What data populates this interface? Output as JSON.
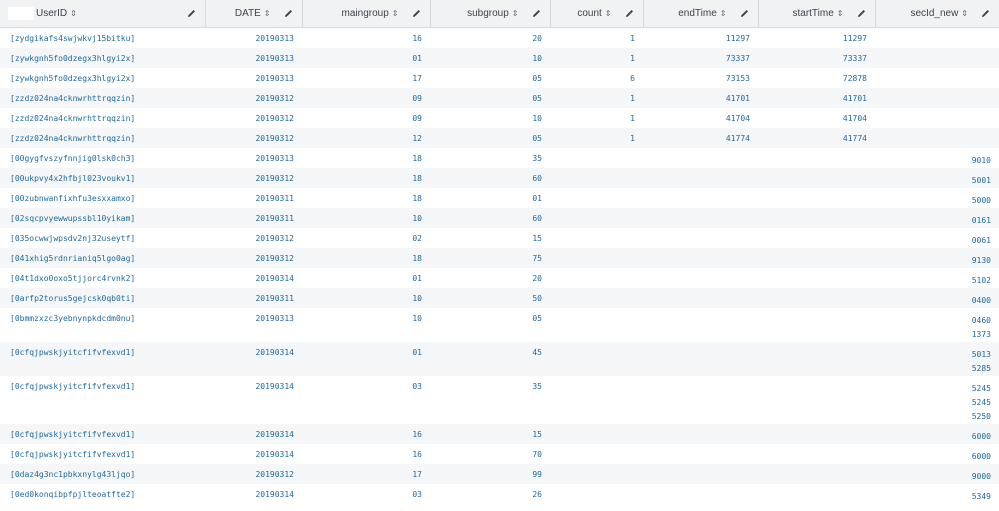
{
  "columns": [
    "UserID",
    "DATE",
    "maingroup",
    "subgroup",
    "count",
    "endTime",
    "startTime",
    "secId_new"
  ],
  "sort_icon": "⇕",
  "rows": [
    {
      "uid": "[zydgikafs4swjwkvj15bitku]",
      "date": "20190313",
      "main": "16",
      "sub": "20",
      "count": "1",
      "end": "11297",
      "start": "11297",
      "sec": []
    },
    {
      "uid": "[zywkgnh5fo0dzegx3hlgyi2x]",
      "date": "20190313",
      "main": "01",
      "sub": "10",
      "count": "1",
      "end": "73337",
      "start": "73337",
      "sec": []
    },
    {
      "uid": "[zywkgnh5fo0dzegx3hlgyi2x]",
      "date": "20190313",
      "main": "17",
      "sub": "05",
      "count": "6",
      "end": "73153",
      "start": "72878",
      "sec": []
    },
    {
      "uid": "[zzdz024na4cknwrhttrqqzin]",
      "date": "20190312",
      "main": "09",
      "sub": "05",
      "count": "1",
      "end": "41701",
      "start": "41701",
      "sec": []
    },
    {
      "uid": "[zzdz024na4cknwrhttrqqzin]",
      "date": "20190312",
      "main": "09",
      "sub": "10",
      "count": "1",
      "end": "41704",
      "start": "41704",
      "sec": []
    },
    {
      "uid": "[zzdz024na4cknwrhttrqqzin]",
      "date": "20190312",
      "main": "12",
      "sub": "05",
      "count": "1",
      "end": "41774",
      "start": "41774",
      "sec": []
    },
    {
      "uid": "[00gygfvszyfnnjig0lsk0ch3]",
      "date": "20190313",
      "main": "18",
      "sub": "35",
      "count": "",
      "end": "",
      "start": "",
      "sec": [
        "9010"
      ]
    },
    {
      "uid": "[00ukpvy4x2hfbjl023voukv1]",
      "date": "20190312",
      "main": "18",
      "sub": "60",
      "count": "",
      "end": "",
      "start": "",
      "sec": [
        "5001"
      ]
    },
    {
      "uid": "[00zubnwanfixhfu3esxxamxo]",
      "date": "20190311",
      "main": "18",
      "sub": "01",
      "count": "",
      "end": "",
      "start": "",
      "sec": [
        "5000"
      ]
    },
    {
      "uid": "[02sqcpvyewwupssbl10yikam]",
      "date": "20190311",
      "main": "10",
      "sub": "60",
      "count": "",
      "end": "",
      "start": "",
      "sec": [
        "0161"
      ]
    },
    {
      "uid": "[035ocwwjwpsdv2nj32useytf]",
      "date": "20190312",
      "main": "02",
      "sub": "15",
      "count": "",
      "end": "",
      "start": "",
      "sec": [
        "0061"
      ]
    },
    {
      "uid": "[041xhig5rdnrianiq5lgo0ag]",
      "date": "20190312",
      "main": "18",
      "sub": "75",
      "count": "",
      "end": "",
      "start": "",
      "sec": [
        "9130"
      ]
    },
    {
      "uid": "[04t1dxo0oxo5tjjorc4rvnk2]",
      "date": "20190314",
      "main": "01",
      "sub": "20",
      "count": "",
      "end": "",
      "start": "",
      "sec": [
        "5102"
      ]
    },
    {
      "uid": "[0arfp2torus5gejcsk0qb0ti]",
      "date": "20190311",
      "main": "10",
      "sub": "50",
      "count": "",
      "end": "",
      "start": "",
      "sec": [
        "0400"
      ]
    },
    {
      "uid": "[0bmmzxzc3yebnynpkdcdm0nu]",
      "date": "20190313",
      "main": "10",
      "sub": "05",
      "count": "",
      "end": "",
      "start": "",
      "sec": [
        "0460",
        "1373"
      ]
    },
    {
      "uid": "[0cfqjpwskjyitcfifvfexvd1]",
      "date": "20190314",
      "main": "01",
      "sub": "45",
      "count": "",
      "end": "",
      "start": "",
      "sec": [
        "5013",
        "5285"
      ]
    },
    {
      "uid": "[0cfqjpwskjyitcfifvfexvd1]",
      "date": "20190314",
      "main": "03",
      "sub": "35",
      "count": "",
      "end": "",
      "start": "",
      "sec": [
        "5245",
        "5245",
        "5250"
      ]
    },
    {
      "uid": "[0cfqjpwskjyitcfifvfexvd1]",
      "date": "20190314",
      "main": "16",
      "sub": "15",
      "count": "",
      "end": "",
      "start": "",
      "sec": [
        "6000"
      ]
    },
    {
      "uid": "[0cfqjpwskjyitcfifvfexvd1]",
      "date": "20190314",
      "main": "16",
      "sub": "70",
      "count": "",
      "end": "",
      "start": "",
      "sec": [
        "6000"
      ]
    },
    {
      "uid": "[0daz4g3nc1pbkxnylg43ljqo]",
      "date": "20190312",
      "main": "17",
      "sub": "99",
      "count": "",
      "end": "",
      "start": "",
      "sec": [
        "9000"
      ]
    },
    {
      "uid": "[0ed0konqibpfpjlteoatfte2]",
      "date": "20190314",
      "main": "03",
      "sub": "26",
      "count": "",
      "end": "",
      "start": "",
      "sec": [
        "5349"
      ]
    }
  ]
}
